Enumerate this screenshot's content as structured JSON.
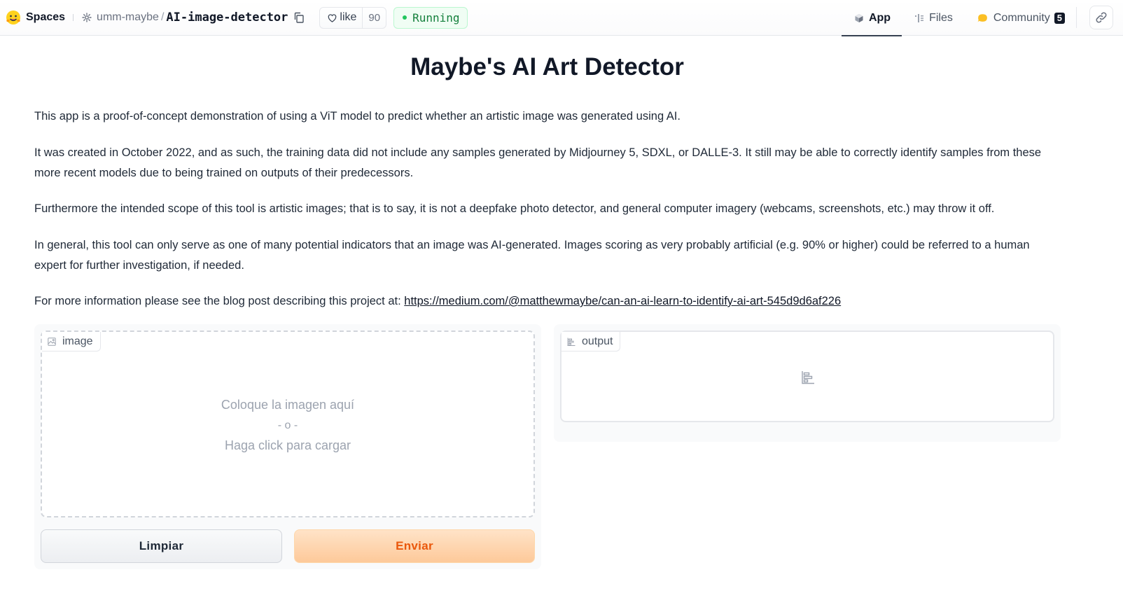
{
  "header": {
    "spaces_label": "Spaces",
    "owner": "umm-maybe",
    "separator": "/",
    "repo": "AI-image-detector",
    "like_label": "like",
    "like_count": "90",
    "status": "Running",
    "tabs": [
      {
        "label": "App",
        "icon": "app-cube-icon",
        "active": true
      },
      {
        "label": "Files",
        "icon": "files-icon",
        "active": false
      },
      {
        "label": "Community",
        "icon": "community-icon",
        "active": false,
        "badge": "5"
      }
    ]
  },
  "main": {
    "title": "Maybe's AI Art Detector",
    "paragraphs": [
      "This app is a proof-of-concept demonstration of using a ViT model to predict whether an artistic image was generated using AI.",
      "It was created in October 2022, and as such, the training data did not include any samples generated by Midjourney 5, SDXL, or DALLE-3. It still may be able to correctly identify samples from these more recent models due to being trained on outputs of their predecessors.",
      "Furthermore the intended scope of this tool is artistic images; that is to say, it is not a deepfake photo detector, and general computer imagery (webcams, screenshots, etc.) may throw it off.",
      "In general, this tool can only serve as one of many potential indicators that an image was AI-generated. Images scoring as very probably artificial (e.g. 90% or higher) could be referred to a human expert for further investigation, if needed."
    ],
    "more_info_prefix": "For more information please see the blog post describing this project at: ",
    "more_info_link": "https://medium.com/@matthewmaybe/can-an-ai-learn-to-identify-ai-art-545d9d6af226"
  },
  "input_panel": {
    "label": "image",
    "drop_line1": "Coloque la imagen aquí",
    "drop_line2": "- o -",
    "drop_line3": "Haga click para cargar",
    "clear_label": "Limpiar",
    "submit_label": "Enviar"
  },
  "output_panel": {
    "label": "output"
  },
  "colors": {
    "running_green": "#15803d",
    "submit_orange": "#ea580c",
    "submit_bg": "#fdc99a"
  }
}
